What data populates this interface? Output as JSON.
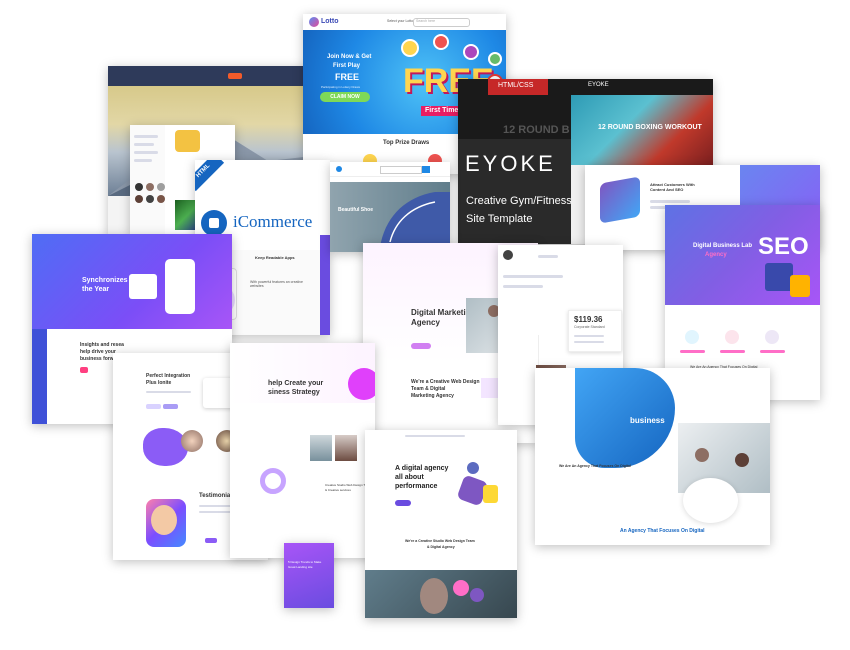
{
  "lotto": {
    "logo": "Lotto",
    "search_placeholder": "Search here",
    "nav_link": "Select your Lotto",
    "hero_line1": "Join Now & Get",
    "hero_line2": "First Play",
    "hero_free": "FREE",
    "hero_sub": "Participating in Lottery Draws",
    "cta": "CLAIM NOW",
    "big_free": "FREE",
    "ribbon": "First Time Pl",
    "section_title": "Top Prize Draws"
  },
  "eyoke": {
    "badge": "HTML/CSS",
    "nav_logo": "EYOKE",
    "hero_bg_text": "12 ROUND B",
    "hero_text": "12 ROUND BOXING WORKOUT",
    "logo": "EYOKE",
    "tagline_line1": "Creative Gym/Fitness",
    "tagline_line2": "Site Template"
  },
  "icommerce": {
    "badge": "HTML",
    "logo": "iCommerce",
    "app_title": "Keep Readable Apps",
    "feature_text": "With powerful features an creative websites"
  },
  "shop": {
    "hero_title": "Beautiful Shoe"
  },
  "agency_left": {
    "hero_line1": "Synchronizes of",
    "hero_line2": "the Year",
    "insight_line1": "Insights and resea",
    "insight_line2": "help drive your",
    "insight_line3": "business forward fa"
  },
  "seo": {
    "title_line1": "Digital Business Lab",
    "title_line2": "Agency",
    "badge": "SEO",
    "footer_text": "We Are An Agency That Focuses On Digital"
  },
  "marketing": {
    "top_card_text": "Attract Customers With Content And SEO",
    "title_line1": "Digital Marketing",
    "title_line2": "Agency",
    "section_line1": "We're a Creative Web Design",
    "section_line2": "Team & Digital",
    "section_line3": "Marketing Agency",
    "price": "$119.36",
    "table_header": "Corporate Standard"
  },
  "business_blob": {
    "title": "business",
    "heading": "We Are An Agency That Focuses On Digital",
    "bottom_text": "An Agency That Focuses On Digital"
  },
  "integration": {
    "title_line1": "Perfect Integration",
    "title_line2": "Plus Ionite",
    "testimonial": "Testimonial"
  },
  "strategy": {
    "title_line1": "help Create your",
    "title_line2": "siness Strategy",
    "team_line1": "Creative Studio Web Design Team",
    "team_line2": "& Creative services"
  },
  "dark_card": {
    "text_line1": "5 Design Trends to Make",
    "text_line2": "Great Landing site"
  },
  "performance": {
    "title_line1": "A digital agency",
    "title_line2": "all about",
    "title_line3": "performance",
    "section_line1": "We're a Creative Studio Web Design Team",
    "section_line2": "& Digital Agency"
  },
  "colors": {
    "blue": "#1e88e5",
    "purple": "#6a4ce0",
    "pink": "#ff6ec7",
    "dark": "#2b2b2b",
    "yellow": "#f3c242"
  }
}
